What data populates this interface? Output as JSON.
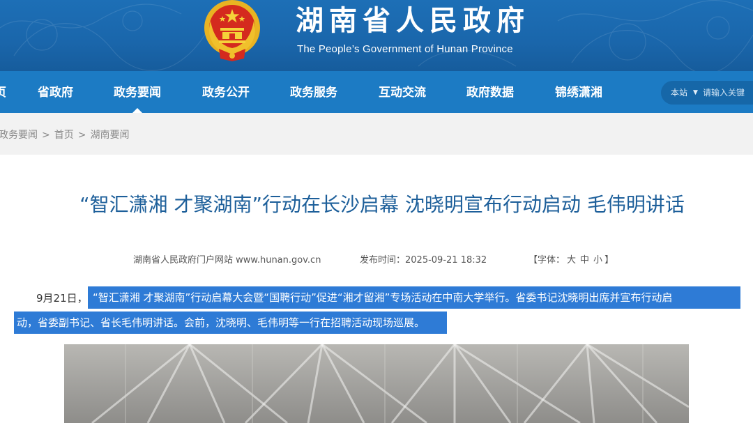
{
  "header": {
    "site_title": "湖南省人民政府",
    "site_subtitle": "The People’s Government of Hunan Province"
  },
  "nav": {
    "items": [
      {
        "label": "页"
      },
      {
        "label": "省政府"
      },
      {
        "label": "政务要闻"
      },
      {
        "label": "政务公开"
      },
      {
        "label": "政务服务"
      },
      {
        "label": "互动交流"
      },
      {
        "label": "政府数据"
      },
      {
        "label": "锦绣潇湘"
      }
    ],
    "active_index": 2,
    "search": {
      "scope": "本站",
      "placeholder": "请输入关键"
    }
  },
  "breadcrumb": {
    "items": [
      "政务要闻",
      "首页",
      "湖南要闻"
    ],
    "separator": ">"
  },
  "article": {
    "title": "“智汇潇湘 才聚湖南”行动在长沙启幕 沈晓明宣布行动启动 毛伟明讲话",
    "source": "湖南省人民政府门户网站 www.hunan.gov.cn",
    "publish_label": "发布时间：",
    "publish_time": "2025-09-21 18:32",
    "font_label": "【字体：",
    "font_sizes": [
      "大",
      "中",
      "小"
    ],
    "font_close": "】",
    "lead_prefix": "9月21日，",
    "lead_line1": "“智汇潇湘 才聚湖南”行动启幕大会暨“国聘行动”促进“湘才留湘”专场活动在中南大学举行。省委书记沈晓明出席并宣布行动启",
    "lead_line2": "动，省委副书记、省长毛伟明讲话。会前，沈晓明、毛伟明等一行在招聘活动现场巡展。"
  },
  "colors": {
    "banner": "#1a66ab",
    "nav": "#1c7bc4",
    "title": "#1d5f9a",
    "highlight": "#2e7bd6"
  },
  "icons": {
    "emblem": "national-emblem-icon"
  }
}
